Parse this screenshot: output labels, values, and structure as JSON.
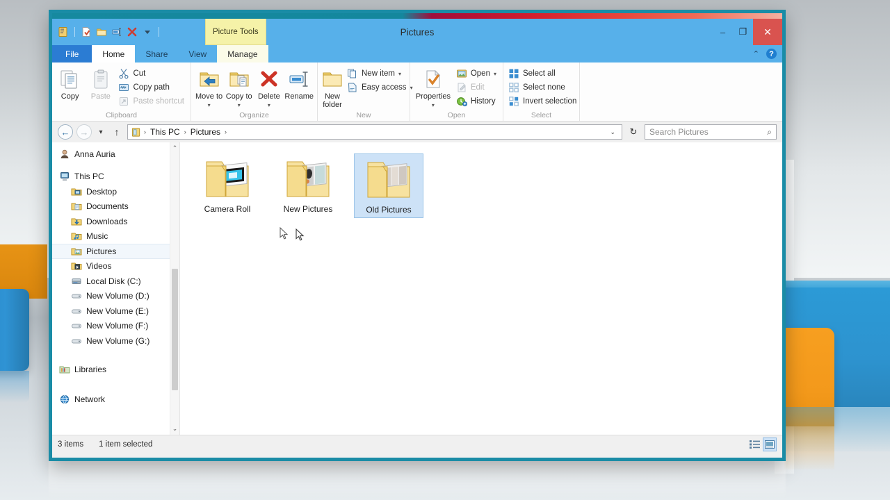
{
  "window": {
    "title": "Pictures",
    "contextual_tab_label": "Picture Tools",
    "buttons": {
      "minimize": "–",
      "maximize": "❐",
      "close": "✕"
    },
    "quick_access": [
      {
        "name": "properties-icon",
        "tooltip": "Properties"
      },
      {
        "name": "new-folder-icon",
        "tooltip": "New folder"
      },
      {
        "name": "folder-icon",
        "tooltip": "Folder"
      },
      {
        "name": "rename-icon",
        "tooltip": "Rename"
      },
      {
        "name": "delete-icon",
        "tooltip": "Delete"
      },
      {
        "name": "customize-dropdown-icon",
        "tooltip": "Customize Quick Access Toolbar"
      }
    ]
  },
  "tabs": [
    {
      "label": "File",
      "state": "file"
    },
    {
      "label": "Home",
      "state": "active"
    },
    {
      "label": "Share",
      "state": "normal"
    },
    {
      "label": "View",
      "state": "normal"
    },
    {
      "label": "Manage",
      "state": "contextual"
    }
  ],
  "ribbon": {
    "collapse_chevron": "⌃",
    "help_label": "?",
    "groups": [
      {
        "label": "Clipboard",
        "big_buttons": [
          {
            "label": "Copy",
            "icon": "copy-icon",
            "enabled": true
          },
          {
            "label": "Paste",
            "icon": "paste-icon",
            "enabled": false
          }
        ],
        "small_buttons": [
          {
            "label": "Cut",
            "icon": "cut-icon",
            "enabled": true
          },
          {
            "label": "Copy path",
            "icon": "copy-path-icon",
            "enabled": true
          },
          {
            "label": "Paste shortcut",
            "icon": "paste-shortcut-icon",
            "enabled": false
          }
        ]
      },
      {
        "label": "Organize",
        "big_buttons": [
          {
            "label": "Move to",
            "icon": "move-to-icon",
            "enabled": true,
            "dropdown": true
          },
          {
            "label": "Copy to",
            "icon": "copy-to-icon",
            "enabled": true,
            "dropdown": true
          },
          {
            "label": "Delete",
            "icon": "delete-icon",
            "enabled": true,
            "dropdown": true
          },
          {
            "label": "Rename",
            "icon": "rename-icon",
            "enabled": true
          }
        ],
        "small_buttons": []
      },
      {
        "label": "New",
        "big_buttons": [
          {
            "label": "New folder",
            "icon": "new-folder-icon",
            "enabled": true
          }
        ],
        "small_buttons": [
          {
            "label": "New item",
            "icon": "new-item-icon",
            "enabled": true,
            "dropdown": true
          },
          {
            "label": "Easy access",
            "icon": "easy-access-icon",
            "enabled": true,
            "dropdown": true
          }
        ]
      },
      {
        "label": "Open",
        "big_buttons": [
          {
            "label": "Properties",
            "icon": "properties-icon",
            "enabled": true,
            "dropdown": true
          }
        ],
        "small_buttons": [
          {
            "label": "Open",
            "icon": "open-icon",
            "enabled": true,
            "dropdown": true
          },
          {
            "label": "Edit",
            "icon": "edit-icon",
            "enabled": false
          },
          {
            "label": "History",
            "icon": "history-icon",
            "enabled": true
          }
        ]
      },
      {
        "label": "Select",
        "big_buttons": [],
        "small_buttons": [
          {
            "label": "Select all",
            "icon": "select-all-icon",
            "enabled": true
          },
          {
            "label": "Select none",
            "icon": "select-none-icon",
            "enabled": true
          },
          {
            "label": "Invert selection",
            "icon": "invert-selection-icon",
            "enabled": true
          }
        ]
      }
    ]
  },
  "navigation": {
    "back_label": "←",
    "forward_label": "→",
    "recent_label": "▾",
    "up_label": "↑",
    "refresh_label": "↻",
    "address_dropdown": "⌄",
    "breadcrumb": [
      "This PC",
      "Pictures"
    ],
    "breadcrumb_separator": "›"
  },
  "search": {
    "placeholder": "Search Pictures",
    "value": "",
    "icon": "search-icon"
  },
  "sidebar": {
    "items": [
      {
        "label": "Anna Auria",
        "icon": "user-icon",
        "level": 1,
        "selected": false,
        "gap_after": true
      },
      {
        "label": "This PC",
        "icon": "this-pc-icon",
        "level": 1,
        "selected": false
      },
      {
        "label": "Desktop",
        "icon": "desktop-folder-icon",
        "level": 2,
        "selected": false
      },
      {
        "label": "Documents",
        "icon": "documents-folder-icon",
        "level": 2,
        "selected": false
      },
      {
        "label": "Downloads",
        "icon": "downloads-folder-icon",
        "level": 2,
        "selected": false
      },
      {
        "label": "Music",
        "icon": "music-folder-icon",
        "level": 2,
        "selected": false
      },
      {
        "label": "Pictures",
        "icon": "pictures-folder-icon",
        "level": 2,
        "selected": true
      },
      {
        "label": "Videos",
        "icon": "videos-folder-icon",
        "level": 2,
        "selected": false
      },
      {
        "label": "Local Disk (C:)",
        "icon": "hard-disk-icon",
        "level": 2,
        "selected": false
      },
      {
        "label": "New Volume (D:)",
        "icon": "drive-icon",
        "level": 2,
        "selected": false
      },
      {
        "label": "New Volume (E:)",
        "icon": "drive-icon",
        "level": 2,
        "selected": false
      },
      {
        "label": "New Volume (F:)",
        "icon": "drive-icon",
        "level": 2,
        "selected": false
      },
      {
        "label": "New Volume (G:)",
        "icon": "drive-icon",
        "level": 2,
        "selected": false,
        "gap_after": true
      },
      {
        "label": "Libraries",
        "icon": "libraries-icon",
        "level": 1,
        "selected": false,
        "gap_after": true
      },
      {
        "label": "Network",
        "icon": "network-icon",
        "level": 1,
        "selected": false
      }
    ],
    "scroll_up": "⌃",
    "scroll_down": "⌄"
  },
  "files": [
    {
      "name": "Camera Roll",
      "type": "folder",
      "selected": false
    },
    {
      "name": "New Pictures",
      "type": "folder",
      "selected": false
    },
    {
      "name": "Old Pictures",
      "type": "folder",
      "selected": true
    }
  ],
  "status": {
    "item_count": "3 items",
    "selection": "1 item selected",
    "views": [
      {
        "name": "details-view-button",
        "active": false
      },
      {
        "name": "large-icons-view-button",
        "active": true
      }
    ]
  },
  "colors": {
    "title_bar": "#57b0ea",
    "window_border": "#1a8ca6",
    "file_tab": "#2b7cd3",
    "contextual_tab": "#f5f2a8",
    "selection": "#cde2f7",
    "close_button": "#d9534f"
  }
}
